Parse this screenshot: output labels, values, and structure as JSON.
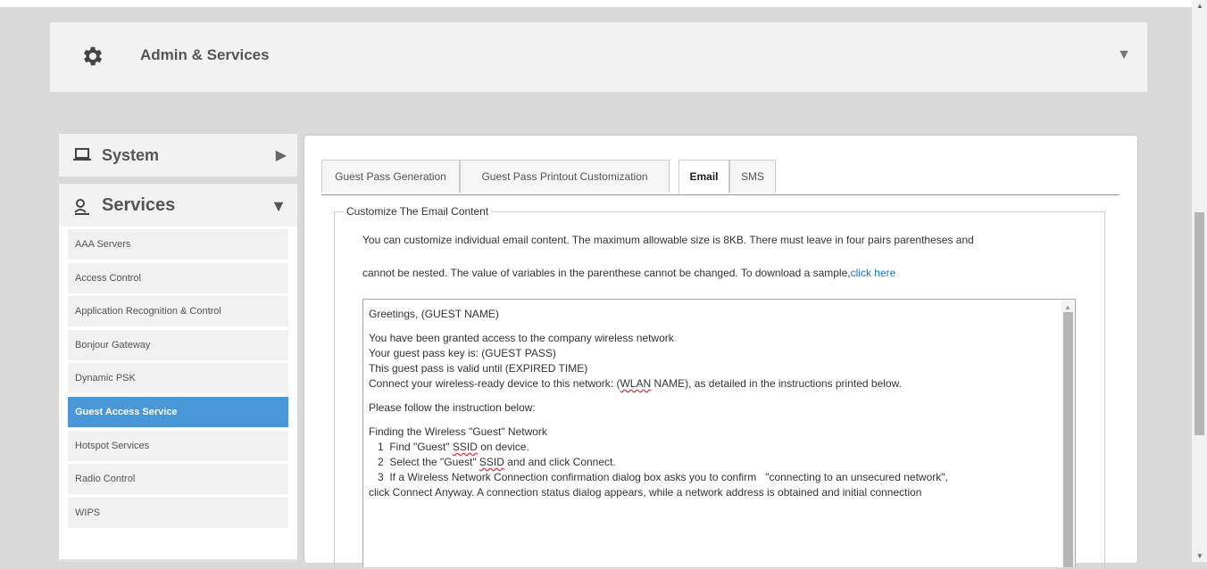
{
  "header": {
    "title": "Admin & Services"
  },
  "sidebar": {
    "system_label": "System",
    "services_label": "Services",
    "items": [
      {
        "label": "AAA Servers"
      },
      {
        "label": "Access Control"
      },
      {
        "label": "Application Recognition & Control"
      },
      {
        "label": "Bonjour Gateway"
      },
      {
        "label": "Dynamic PSK"
      },
      {
        "label": "Guest Access Service",
        "active": true
      },
      {
        "label": "Hotspot Services"
      },
      {
        "label": "Radio Control"
      },
      {
        "label": "WIPS"
      }
    ]
  },
  "tabs": [
    {
      "label": "Guest Pass Generation"
    },
    {
      "label": "Guest Pass Printout Customization"
    },
    {
      "label": "Email",
      "active": true
    },
    {
      "label": "SMS"
    }
  ],
  "email": {
    "legend": "Customize The Email Content",
    "desc_line1": "You can customize individual email content. The maximum allowable size is 8KB. There must leave in four pairs parentheses and",
    "desc_line2": "cannot be nested. The value of variables in the parenthese cannot be changed. To download a sample,",
    "desc_link": "click here",
    "body": {
      "greeting": "Greetings, (GUEST NAME)",
      "l1": "You have been granted access to the company wireless network",
      "l2": "Your guest pass key is: (GUEST PASS)",
      "l3": "This guest pass is valid until (EXPIRED TIME)",
      "l4a": "Connect your wireless-ready device to this network: (",
      "l4u": "WLAN",
      "l4b": " NAME), as detailed in the instructions printed below.",
      "l5": "Please follow the instruction below:",
      "l6": "Finding the Wireless \"Guest\" Network",
      "s1a": "   1  Find \"Guest\" ",
      "s1u": "SSID",
      "s1b": " on device.",
      "s2a": "   2  Select the \"Guest\" ",
      "s2u": "SSID",
      "s2b": " and and click Connect.",
      "s3": "   3  If a Wireless Network Connection confirmation dialog box asks you to confirm   \"connecting to an unsecured network\",",
      "s3b": "click Connect Anyway. A connection status dialog appears, while a network address is obtained and initial connection"
    }
  }
}
